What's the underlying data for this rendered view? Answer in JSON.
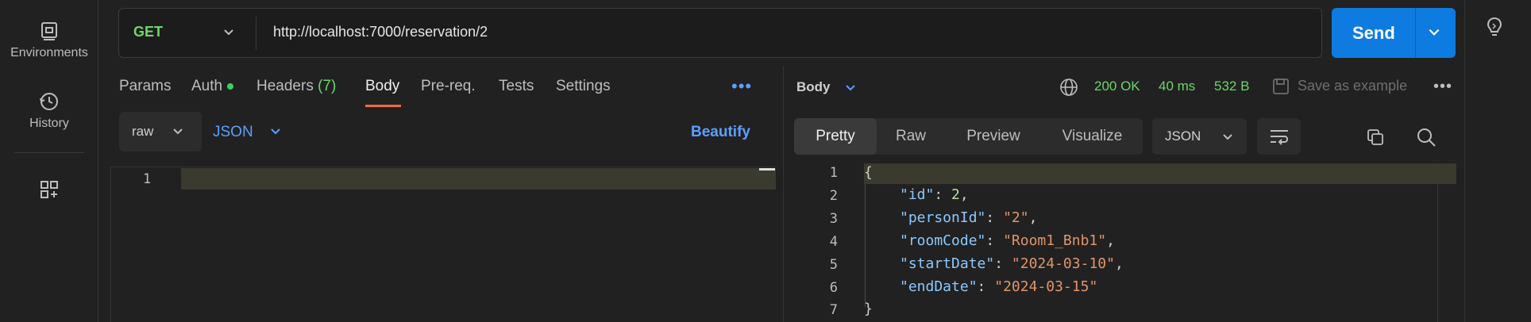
{
  "rail": {
    "environments_label": "Environments",
    "history_label": "History"
  },
  "request": {
    "method": "GET",
    "url": "http://localhost:7000/reservation/2",
    "send_label": "Send"
  },
  "req_tabs": {
    "params": "Params",
    "auth": "Auth",
    "headers": "Headers",
    "headers_count": "(7)",
    "body": "Body",
    "prereq": "Pre-req.",
    "tests": "Tests",
    "settings": "Settings",
    "more": "•••"
  },
  "body_options": {
    "mode": "raw",
    "format": "JSON",
    "beautify_label": "Beautify"
  },
  "editor": {
    "line_numbers": [
      "1"
    ]
  },
  "response": {
    "label": "Body",
    "status": "200 OK",
    "time": "40 ms",
    "size": "532 B",
    "save_label": "Save as example",
    "more": "•••",
    "view_tabs": [
      "Pretty",
      "Raw",
      "Preview",
      "Visualize"
    ],
    "format": "JSON",
    "lines": [
      {
        "num": "1",
        "open": "{"
      },
      {
        "num": "2",
        "key": "\"id\"",
        "value": "2",
        "type": "number",
        "comma": ","
      },
      {
        "num": "3",
        "key": "\"personId\"",
        "value": "\"2\"",
        "type": "string",
        "comma": ","
      },
      {
        "num": "4",
        "key": "\"roomCode\"",
        "value": "\"Room1_Bnb1\"",
        "type": "string",
        "comma": ","
      },
      {
        "num": "5",
        "key": "\"startDate\"",
        "value": "\"2024-03-10\"",
        "type": "string",
        "comma": ","
      },
      {
        "num": "6",
        "key": "\"endDate\"",
        "value": "\"2024-03-15\"",
        "type": "string",
        "comma": ""
      },
      {
        "num": "7",
        "close": "}"
      }
    ]
  },
  "colors": {
    "accent": "#0d7be0",
    "method_get": "#6bd66b",
    "active_tab_underline": "#f26b3a",
    "link_blue": "#5aa0ff"
  }
}
